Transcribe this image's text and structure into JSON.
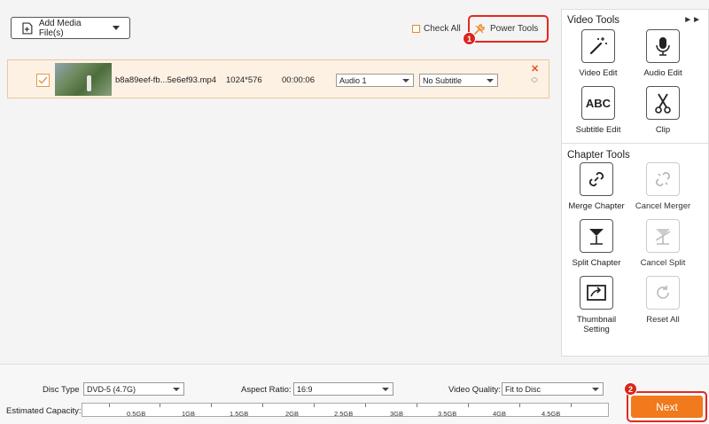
{
  "toolbar": {
    "add_media_label": "Add Media File(s)",
    "check_all_label": "Check All",
    "power_tools_label": "Power Tools"
  },
  "callouts": {
    "step1": "1",
    "step2": "2"
  },
  "media": {
    "filename": "b8a89eef-fb...5e6ef93.mp4",
    "resolution": "1024*576",
    "duration": "00:00:06",
    "audio_track": "Audio 1",
    "subtitle": "No Subtitle",
    "checked": true
  },
  "panel": {
    "video_tools_title": "Video Tools",
    "chapter_tools_title": "Chapter Tools",
    "video_tools": [
      {
        "label": "Video Edit",
        "icon": "magic-wand-icon"
      },
      {
        "label": "Audio Edit",
        "icon": "microphone-icon"
      },
      {
        "label": "Subtitle Edit",
        "icon": "abc-text-icon",
        "text": "ABC"
      },
      {
        "label": "Clip",
        "icon": "scissors-icon"
      }
    ],
    "chapter_tools": [
      {
        "label": "Merge Chapter",
        "icon": "link-icon",
        "enabled": true
      },
      {
        "label": "Cancel Merger",
        "icon": "broken-link-icon",
        "enabled": false
      },
      {
        "label": "Split Chapter",
        "icon": "split-marker-icon",
        "enabled": true
      },
      {
        "label": "Cancel Split",
        "icon": "cancel-split-icon",
        "enabled": false
      },
      {
        "label": "Thumbnail Setting",
        "icon": "thumbnail-icon",
        "enabled": true
      },
      {
        "label": "Reset All",
        "icon": "reset-icon",
        "enabled": false
      }
    ]
  },
  "bottom": {
    "disc_type_label": "Disc Type",
    "disc_type_value": "DVD-5 (4.7G)",
    "aspect_ratio_label": "Aspect Ratio:",
    "aspect_ratio_value": "16:9",
    "video_quality_label": "Video Quality:",
    "video_quality_value": "Fit to Disc",
    "estimated_capacity_label": "Estimated Capacity:",
    "capacity_ticks": [
      "0.5GB",
      "1GB",
      "1.5GB",
      "2GB",
      "2.5GB",
      "3GB",
      "3.5GB",
      "4GB",
      "4.5GB"
    ],
    "next_label": "Next"
  },
  "colors": {
    "accent_orange": "#f07a1c",
    "highlight_red": "#e4281f",
    "row_bg": "#fdf1e4"
  }
}
